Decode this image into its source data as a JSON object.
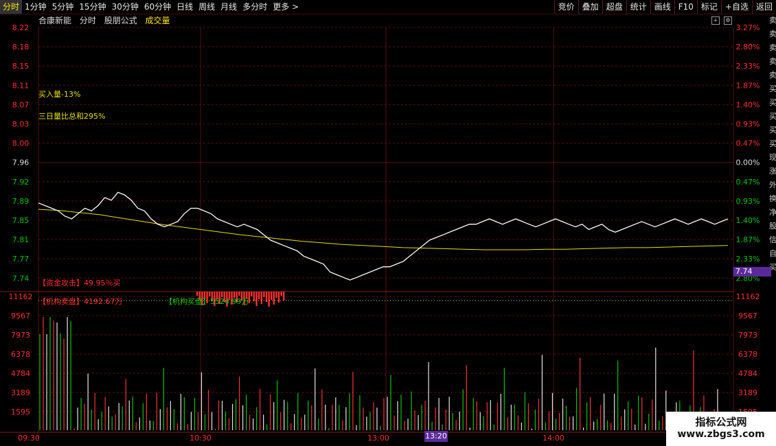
{
  "topbar": {
    "tabs": [
      "分时",
      "1分钟",
      "5分钟",
      "15分钟",
      "30分钟",
      "60分钟",
      "日线",
      "周线",
      "月线",
      "多分时",
      "更多 >"
    ],
    "active_tab": 0,
    "tools": [
      "竞价",
      "叠加",
      "超盘",
      "统计",
      "画线",
      "F10",
      "标记",
      "+自选",
      "返回"
    ]
  },
  "header": {
    "name": "合康新能",
    "mode": "分时",
    "formula": "股朋公式",
    "volume_label": "成交量"
  },
  "price_axis_left": [
    "8.22",
    "8.18",
    "8.15",
    "8.11",
    "8.07",
    "8.03",
    "8.00",
    "7.96",
    "7.92",
    "7.89",
    "7.85",
    "7.81",
    "7.77",
    "7.74"
  ],
  "pct_axis_right": [
    "3.27%",
    "2.80%",
    "2.33%",
    "1.87%",
    "1.40%",
    "0.93%",
    "0.47%",
    "0.00%",
    "0.47%",
    "0.93%",
    "1.40%",
    "1.87%",
    "2.33%",
    "2.80%"
  ],
  "volume_axis": [
    "11162",
    "9567",
    "7973",
    "6378",
    "4784",
    "3189",
    "1595"
  ],
  "time_axis": [
    "09:30",
    "10:30",
    "13:00",
    "14:00"
  ],
  "cursor_time": "13:20",
  "current_price_tag": "7.74",
  "annotations": {
    "buy_in": "买入量-13%",
    "three_day": "三日量比总和295%",
    "attack": "【资金攻击】49.95％买",
    "inst_sell": "【机构卖盘】4192.67万",
    "inst_buy": "【机构买盘】5524.99万"
  },
  "side_column": [
    "卖",
    "卖",
    "卖",
    "卖",
    "卖",
    "买",
    "买",
    "买",
    "买",
    "买",
    "现",
    "涨",
    "外",
    "换",
    "净",
    "股",
    "信",
    "自",
    "买"
  ],
  "watermark": {
    "line1": "指标公式网",
    "line2": "www.zbgs3.com"
  },
  "colors": {
    "up": "#ff3030",
    "down": "#00c800",
    "price_line": "#ffffff",
    "avg_line": "#e8e000",
    "grid": "#5a0f0f",
    "axis_text": "#ff3030"
  },
  "chart_data": {
    "type": "line",
    "price": [
      7.89,
      7.885,
      7.88,
      7.875,
      7.865,
      7.86,
      7.87,
      7.88,
      7.875,
      7.885,
      7.9,
      7.895,
      7.91,
      7.905,
      7.895,
      7.88,
      7.875,
      7.86,
      7.85,
      7.845,
      7.85,
      7.855,
      7.87,
      7.88,
      7.88,
      7.875,
      7.87,
      7.86,
      7.855,
      7.85,
      7.845,
      7.85,
      7.845,
      7.84,
      7.83,
      7.82,
      7.815,
      7.81,
      7.805,
      7.8,
      7.79,
      7.785,
      7.78,
      7.775,
      7.76,
      7.755,
      7.75,
      7.745,
      7.75,
      7.755,
      7.76,
      7.765,
      7.77,
      7.77,
      7.775,
      7.78,
      7.79,
      7.8,
      7.81,
      7.82,
      7.825,
      7.83,
      7.835,
      7.84,
      7.845,
      7.85,
      7.85,
      7.855,
      7.86,
      7.855,
      7.85,
      7.855,
      7.86,
      7.855,
      7.85,
      7.845,
      7.85,
      7.855,
      7.86,
      7.855,
      7.85,
      7.845,
      7.85,
      7.84,
      7.845,
      7.85,
      7.84,
      7.835,
      7.84,
      7.845,
      7.85,
      7.855,
      7.85,
      7.845,
      7.85,
      7.855,
      7.86,
      7.855,
      7.85,
      7.855,
      7.86,
      7.855,
      7.85,
      7.855,
      7.86
    ],
    "avg_price": [
      7.878,
      7.876,
      7.872,
      7.868,
      7.862,
      7.856,
      7.85,
      7.845,
      7.84,
      7.835,
      7.83,
      7.826,
      7.822,
      7.818,
      7.815,
      7.812,
      7.81,
      7.808,
      7.806,
      7.805,
      7.804,
      7.803,
      7.802,
      7.802,
      7.802,
      7.803,
      7.803,
      7.804,
      7.805,
      7.806,
      7.806,
      7.807,
      7.808,
      7.809,
      7.81
    ],
    "ylim": [
      7.74,
      8.22
    ],
    "prev_close": 7.96,
    "xlabel": "",
    "ylabel": ""
  }
}
